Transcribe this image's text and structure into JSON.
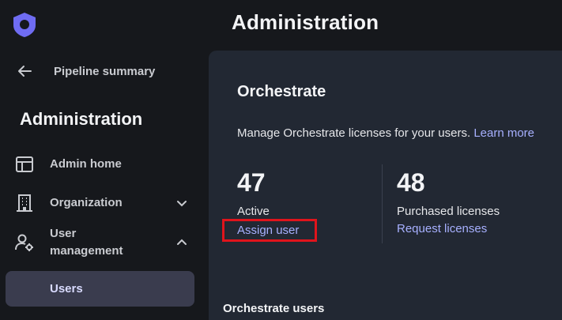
{
  "header": {
    "title": "Administration"
  },
  "sidebar": {
    "back_label": "Pipeline summary",
    "title": "Administration",
    "items": [
      {
        "label": "Admin home",
        "icon": "layout-icon"
      },
      {
        "label": "Organization",
        "icon": "building-icon"
      },
      {
        "label": "User management",
        "icon": "user-gear-icon"
      },
      {
        "label": "Users"
      }
    ]
  },
  "main": {
    "title": "Orchestrate",
    "description": "Manage Orchestrate licenses for your users.",
    "learn_more": "Learn more",
    "active_count": "47",
    "active_label": "Active",
    "assign_user": "Assign user",
    "purchased_count": "48",
    "purchased_label": "Purchased licenses",
    "request_licenses": "Request licenses",
    "users_section": "Orchestrate users"
  },
  "colors": {
    "background": "#16181c",
    "panel": "#222833",
    "accent_link": "#a7b0ff",
    "logo": "#6f6cf2",
    "highlight_box": "#e0141c",
    "active_nav": "#3a3c4e"
  }
}
